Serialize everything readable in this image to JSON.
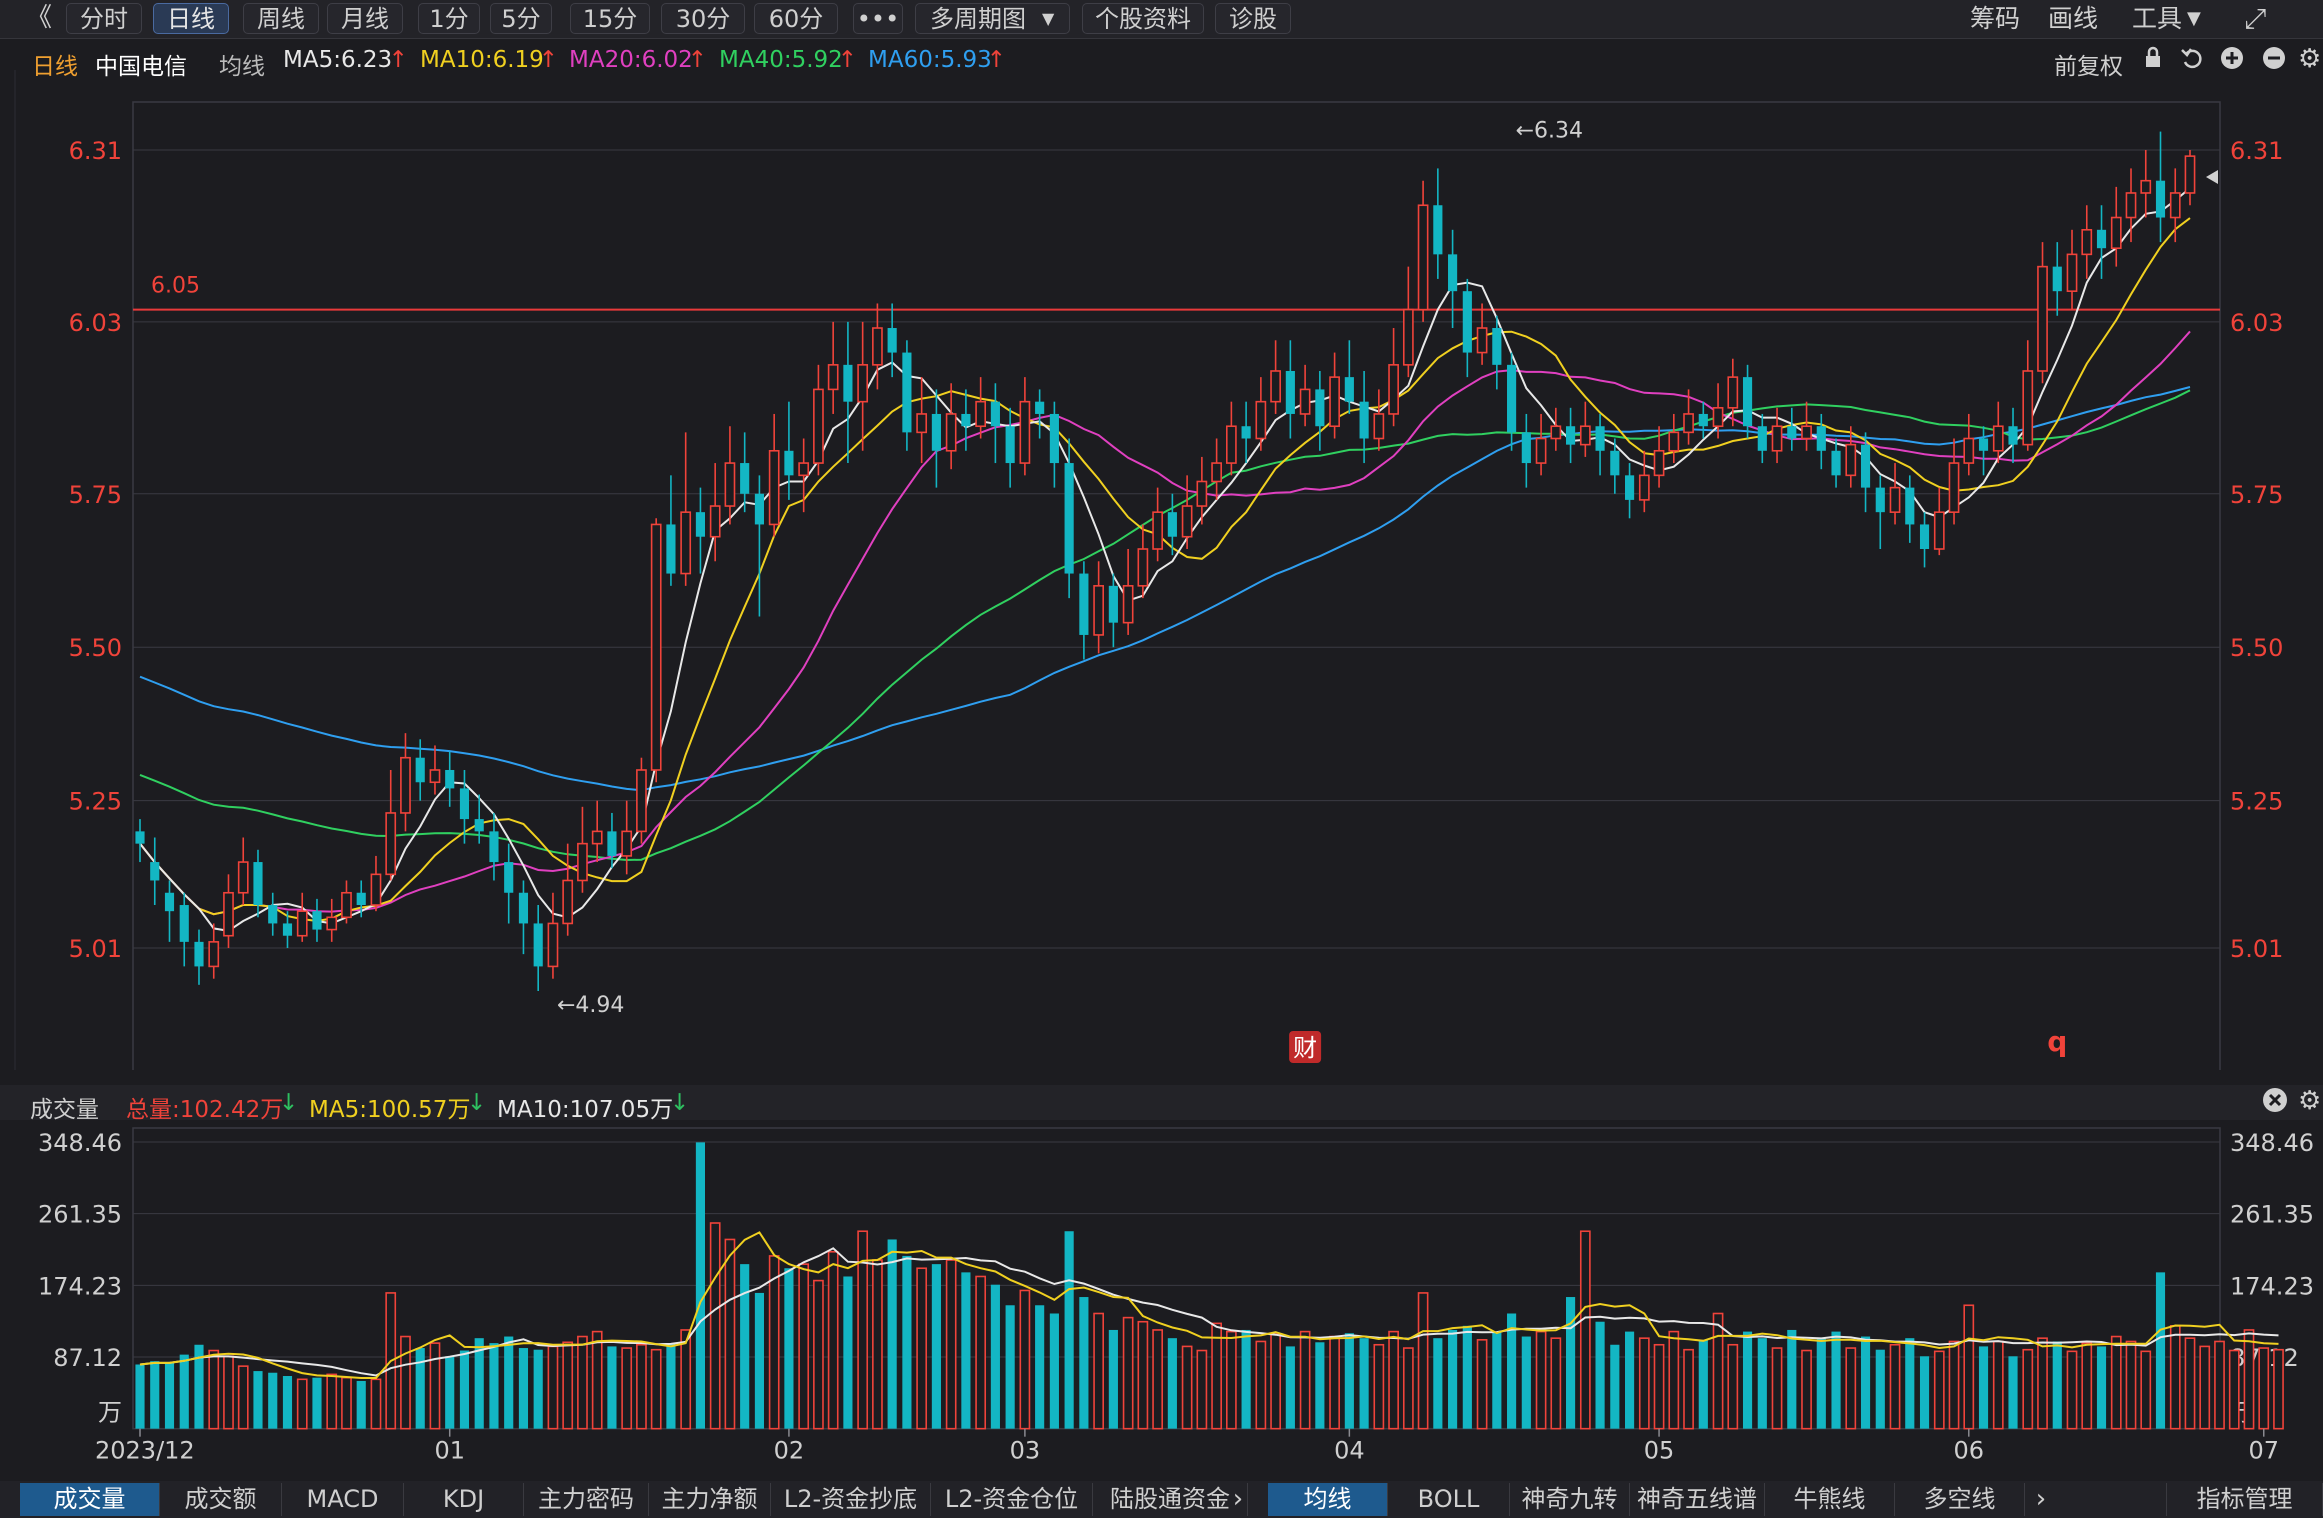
{
  "toolbar": {
    "collapse": "《",
    "periods": [
      "分时",
      "日线",
      "周线",
      "月线",
      "1分",
      "5分",
      "15分",
      "30分",
      "60分",
      "•••",
      "多周期图",
      "个股资料",
      "诊股"
    ],
    "active_period": "日线",
    "right": [
      "筹码",
      "画线",
      "工具"
    ],
    "fullscreen_glyph": "⤢"
  },
  "main_info": {
    "period": "日线",
    "stock": "中国电信",
    "ma_label": "均线",
    "ma": [
      {
        "label": "MA5:6.23",
        "arrow": "↑",
        "color": "#e8e8e8"
      },
      {
        "label": "MA10:6.19",
        "arrow": "↑",
        "color": "#f0d020"
      },
      {
        "label": "MA20:6.02",
        "arrow": "↑",
        "color": "#e040c0"
      },
      {
        "label": "MA40:5.92",
        "arrow": "↑",
        "color": "#30d060"
      },
      {
        "label": "MA60:5.93",
        "arrow": "↑",
        "color": "#2f9ff0"
      }
    ],
    "adjust": "前复权"
  },
  "vol_info": {
    "title": "成交量",
    "total": "总量:102.42万",
    "ma5": "MA5:100.57万",
    "ma10": "MA10:107.05万"
  },
  "colors": {
    "up": "#f0433a",
    "down": "#13b6c4",
    "ma5": "#e8e8e8",
    "ma10": "#f0d020",
    "ma20": "#e040c0",
    "ma40": "#30d060",
    "ma60": "#2f9ff0",
    "grid": "#3a3a42",
    "label": "#f0433a"
  },
  "annotations": {
    "high": "←6.34",
    "low": "←4.94",
    "hline": "6.05",
    "fin_badge": "财",
    "q_marker": "q"
  },
  "bottom_tabs_left": [
    "成交量",
    "成交额",
    "MACD",
    "KDJ",
    "主力密码",
    "主力净额",
    "L2-资金抄底",
    "L2-资金仓位",
    "陆股通资金"
  ],
  "bottom_tabs_right": [
    "均线",
    "BOLL",
    "神奇九转",
    "神奇五线谱",
    "牛熊线",
    "多空线"
  ],
  "bottom_manage": "指标管理",
  "chart_data": {
    "type": "candlestick",
    "title": "中国电信 日线",
    "xlabel": "",
    "ylabel": "",
    "x_tick_labels": [
      "2023/12",
      "01",
      "02",
      "03",
      "04",
      "05",
      "06",
      "07"
    ],
    "x_tick_index": [
      0,
      21,
      44,
      60,
      82,
      103,
      124,
      144
    ],
    "price_ticks": [
      5.01,
      5.25,
      5.5,
      5.75,
      6.03,
      6.31
    ],
    "ylim": [
      4.84,
      6.5
    ],
    "hline_value": 6.05,
    "high_value": 6.34,
    "high_index": 93,
    "low_value": 4.94,
    "low_index": 28,
    "fin_badge_index": 79,
    "q_marker_index": 130,
    "volume_ticks": [
      87.12,
      174.23,
      261.35,
      348.46
    ],
    "volume_unit": "万",
    "volume_ylim": [
      0,
      355
    ],
    "grid": true,
    "series_names": [
      "MA5",
      "MA10",
      "MA20",
      "MA40",
      "MA60"
    ],
    "candles": [
      [
        5.2,
        5.18,
        5.22,
        5.15
      ],
      [
        5.15,
        5.12,
        5.19,
        5.08
      ],
      [
        5.1,
        5.07,
        5.12,
        5.02
      ],
      [
        5.08,
        5.02,
        5.1,
        4.98
      ],
      [
        5.02,
        4.98,
        5.04,
        4.95
      ],
      [
        4.98,
        5.02,
        5.05,
        4.96
      ],
      [
        5.03,
        5.1,
        5.13,
        5.01
      ],
      [
        5.1,
        5.15,
        5.19,
        5.08
      ],
      [
        5.15,
        5.08,
        5.17,
        5.06
      ],
      [
        5.08,
        5.05,
        5.1,
        5.03
      ],
      [
        5.05,
        5.03,
        5.07,
        5.01
      ],
      [
        5.03,
        5.07,
        5.1,
        5.02
      ],
      [
        5.07,
        5.04,
        5.09,
        5.02
      ],
      [
        5.04,
        5.06,
        5.09,
        5.02
      ],
      [
        5.06,
        5.1,
        5.12,
        5.05
      ],
      [
        5.1,
        5.08,
        5.12,
        5.06
      ],
      [
        5.08,
        5.13,
        5.16,
        5.07
      ],
      [
        5.13,
        5.23,
        5.3,
        5.12
      ],
      [
        5.23,
        5.32,
        5.36,
        5.2
      ],
      [
        5.32,
        5.28,
        5.35,
        5.25
      ],
      [
        5.28,
        5.3,
        5.34,
        5.26
      ],
      [
        5.3,
        5.27,
        5.33,
        5.24
      ],
      [
        5.27,
        5.22,
        5.3,
        5.18
      ],
      [
        5.22,
        5.2,
        5.26,
        5.18
      ],
      [
        5.2,
        5.15,
        5.23,
        5.12
      ],
      [
        5.15,
        5.1,
        5.18,
        5.05
      ],
      [
        5.1,
        5.05,
        5.12,
        5.0
      ],
      [
        5.05,
        4.98,
        5.08,
        4.94
      ],
      [
        4.98,
        5.05,
        5.1,
        4.96
      ],
      [
        5.05,
        5.12,
        5.18,
        5.03
      ],
      [
        5.12,
        5.18,
        5.24,
        5.1
      ],
      [
        5.18,
        5.2,
        5.25,
        5.15
      ],
      [
        5.2,
        5.16,
        5.23,
        5.14
      ],
      [
        5.16,
        5.2,
        5.25,
        5.13
      ],
      [
        5.2,
        5.3,
        5.32,
        5.18
      ],
      [
        5.3,
        5.7,
        5.71,
        5.28
      ],
      [
        5.7,
        5.62,
        5.78,
        5.6
      ],
      [
        5.62,
        5.72,
        5.85,
        5.6
      ],
      [
        5.72,
        5.68,
        5.76,
        5.62
      ],
      [
        5.68,
        5.73,
        5.8,
        5.64
      ],
      [
        5.73,
        5.8,
        5.86,
        5.7
      ],
      [
        5.8,
        5.75,
        5.85,
        5.72
      ],
      [
        5.75,
        5.7,
        5.78,
        5.55
      ],
      [
        5.7,
        5.82,
        5.88,
        5.68
      ],
      [
        5.82,
        5.78,
        5.9,
        5.74
      ],
      [
        5.78,
        5.8,
        5.84,
        5.72
      ],
      [
        5.8,
        5.92,
        5.96,
        5.78
      ],
      [
        5.92,
        5.96,
        6.03,
        5.88
      ],
      [
        5.96,
        5.9,
        6.03,
        5.8
      ],
      [
        5.9,
        5.96,
        6.03,
        5.82
      ],
      [
        5.96,
        6.02,
        6.06,
        5.92
      ],
      [
        6.02,
        5.98,
        6.06,
        5.94
      ],
      [
        5.98,
        5.85,
        6.0,
        5.82
      ],
      [
        5.85,
        5.88,
        5.94,
        5.8
      ],
      [
        5.88,
        5.82,
        5.92,
        5.76
      ],
      [
        5.82,
        5.88,
        5.93,
        5.79
      ],
      [
        5.88,
        5.86,
        5.92,
        5.82
      ],
      [
        5.86,
        5.9,
        5.94,
        5.84
      ],
      [
        5.9,
        5.86,
        5.93,
        5.8
      ],
      [
        5.86,
        5.8,
        5.89,
        5.76
      ],
      [
        5.8,
        5.9,
        5.94,
        5.78
      ],
      [
        5.9,
        5.88,
        5.92,
        5.84
      ],
      [
        5.88,
        5.8,
        5.9,
        5.76
      ],
      [
        5.8,
        5.62,
        5.84,
        5.58
      ],
      [
        5.62,
        5.52,
        5.64,
        5.48
      ],
      [
        5.52,
        5.6,
        5.64,
        5.49
      ],
      [
        5.6,
        5.54,
        5.62,
        5.5
      ],
      [
        5.54,
        5.6,
        5.66,
        5.52
      ],
      [
        5.6,
        5.66,
        5.7,
        5.58
      ],
      [
        5.66,
        5.72,
        5.76,
        5.64
      ],
      [
        5.72,
        5.68,
        5.75,
        5.65
      ],
      [
        5.68,
        5.73,
        5.78,
        5.66
      ],
      [
        5.73,
        5.77,
        5.81,
        5.7
      ],
      [
        5.77,
        5.8,
        5.84,
        5.74
      ],
      [
        5.8,
        5.86,
        5.9,
        5.78
      ],
      [
        5.86,
        5.84,
        5.9,
        5.8
      ],
      [
        5.84,
        5.9,
        5.94,
        5.82
      ],
      [
        5.9,
        5.95,
        6.0,
        5.88
      ],
      [
        5.95,
        5.88,
        6.0,
        5.84
      ],
      [
        5.88,
        5.92,
        5.96,
        5.86
      ],
      [
        5.92,
        5.86,
        5.95,
        5.82
      ],
      [
        5.86,
        5.94,
        5.98,
        5.84
      ],
      [
        5.94,
        5.9,
        6.0,
        5.88
      ],
      [
        5.9,
        5.84,
        5.95,
        5.8
      ],
      [
        5.84,
        5.88,
        5.92,
        5.82
      ],
      [
        5.88,
        5.96,
        6.02,
        5.86
      ],
      [
        5.96,
        6.05,
        6.12,
        5.94
      ],
      [
        6.05,
        6.22,
        6.26,
        6.03
      ],
      [
        6.22,
        6.14,
        6.28,
        6.1
      ],
      [
        6.14,
        6.08,
        6.18,
        6.02
      ],
      [
        6.08,
        5.98,
        6.1,
        5.94
      ],
      [
        5.98,
        6.02,
        6.06,
        5.96
      ],
      [
        6.02,
        5.96,
        6.04,
        5.92
      ],
      [
        5.96,
        5.85,
        5.98,
        5.82
      ],
      [
        5.85,
        5.8,
        5.88,
        5.76
      ],
      [
        5.8,
        5.84,
        5.88,
        5.78
      ],
      [
        5.84,
        5.86,
        5.89,
        5.82
      ],
      [
        5.86,
        5.83,
        5.89,
        5.8
      ],
      [
        5.83,
        5.86,
        5.9,
        5.81
      ],
      [
        5.86,
        5.82,
        5.88,
        5.78
      ],
      [
        5.82,
        5.78,
        5.84,
        5.75
      ],
      [
        5.78,
        5.74,
        5.8,
        5.71
      ],
      [
        5.74,
        5.78,
        5.82,
        5.72
      ],
      [
        5.78,
        5.82,
        5.86,
        5.76
      ],
      [
        5.82,
        5.85,
        5.88,
        5.8
      ],
      [
        5.85,
        5.88,
        5.92,
        5.83
      ],
      [
        5.88,
        5.86,
        5.9,
        5.84
      ],
      [
        5.86,
        5.89,
        5.93,
        5.84
      ],
      [
        5.89,
        5.94,
        5.97,
        5.86
      ],
      [
        5.94,
        5.86,
        5.96,
        5.84
      ],
      [
        5.86,
        5.82,
        5.88,
        5.8
      ],
      [
        5.82,
        5.86,
        5.89,
        5.8
      ],
      [
        5.86,
        5.84,
        5.89,
        5.82
      ],
      [
        5.84,
        5.86,
        5.9,
        5.82
      ],
      [
        5.86,
        5.82,
        5.88,
        5.79
      ],
      [
        5.82,
        5.78,
        5.84,
        5.76
      ],
      [
        5.78,
        5.83,
        5.86,
        5.76
      ],
      [
        5.83,
        5.76,
        5.85,
        5.72
      ],
      [
        5.76,
        5.72,
        5.78,
        5.66
      ],
      [
        5.72,
        5.76,
        5.8,
        5.7
      ],
      [
        5.76,
        5.7,
        5.78,
        5.67
      ],
      [
        5.7,
        5.66,
        5.72,
        5.63
      ],
      [
        5.66,
        5.72,
        5.76,
        5.65
      ],
      [
        5.72,
        5.8,
        5.84,
        5.7
      ],
      [
        5.8,
        5.84,
        5.88,
        5.78
      ],
      [
        5.84,
        5.82,
        5.86,
        5.78
      ],
      [
        5.82,
        5.86,
        5.9,
        5.8
      ],
      [
        5.86,
        5.83,
        5.89,
        5.8
      ],
      [
        5.83,
        5.95,
        6.0,
        5.82
      ],
      [
        5.95,
        6.12,
        6.16,
        5.93
      ],
      [
        6.12,
        6.08,
        6.16,
        6.04
      ],
      [
        6.08,
        6.14,
        6.18,
        6.05
      ],
      [
        6.14,
        6.18,
        6.22,
        6.1
      ],
      [
        6.18,
        6.15,
        6.22,
        6.1
      ],
      [
        6.15,
        6.2,
        6.25,
        6.12
      ],
      [
        6.2,
        6.24,
        6.28,
        6.16
      ],
      [
        6.24,
        6.26,
        6.31,
        6.2
      ],
      [
        6.26,
        6.2,
        6.34,
        6.16
      ],
      [
        6.2,
        6.24,
        6.28,
        6.16
      ],
      [
        6.24,
        6.3,
        6.31,
        6.22
      ]
    ],
    "volume": [
      78,
      82,
      80,
      90,
      102,
      95,
      88,
      76,
      70,
      68,
      64,
      60,
      62,
      66,
      62,
      58,
      60,
      165,
      112,
      98,
      104,
      88,
      95,
      110,
      104,
      112,
      98,
      96,
      100,
      105,
      112,
      118,
      100,
      98,
      102,
      96,
      104,
      120,
      348,
      250,
      230,
      200,
      165,
      210,
      195,
      200,
      180,
      215,
      185,
      240,
      205,
      230,
      210,
      195,
      200,
      205,
      190,
      185,
      175,
      150,
      168,
      150,
      140,
      240,
      160,
      140,
      120,
      135,
      130,
      120,
      110,
      100,
      95,
      128,
      118,
      120,
      106,
      115,
      100,
      118,
      105,
      112,
      116,
      110,
      102,
      118,
      98,
      165,
      110,
      120,
      125,
      108,
      118,
      140,
      112,
      118,
      110,
      160,
      240,
      130,
      102,
      118,
      110,
      102,
      118,
      96,
      108,
      140,
      102,
      118,
      110,
      98,
      120,
      95,
      110,
      118,
      98,
      112,
      96,
      102,
      110,
      88,
      94,
      106,
      150,
      100,
      106,
      88,
      96,
      110,
      106,
      94,
      104,
      100,
      112,
      106,
      94,
      190,
      125,
      110,
      100,
      106,
      95,
      120,
      98,
      96
    ]
  }
}
